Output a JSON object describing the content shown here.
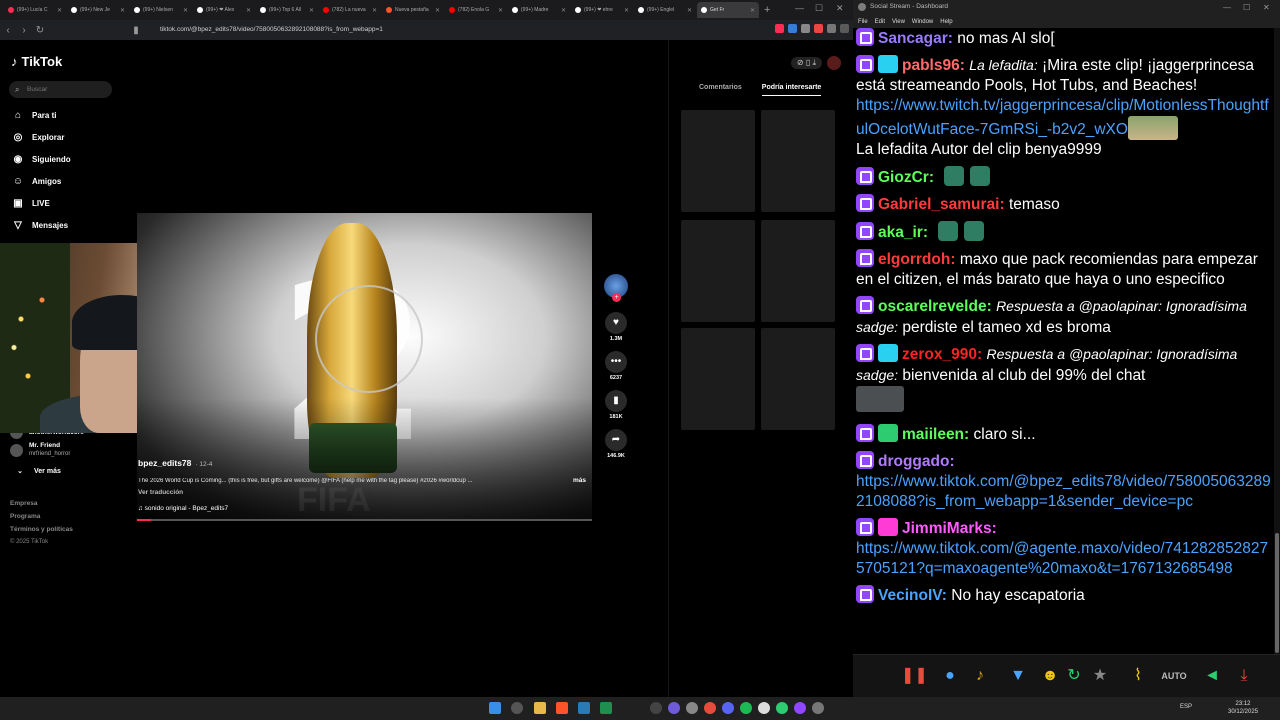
{
  "browser": {
    "tabs": [
      {
        "label": "(99+) Lucía C",
        "color": "#fe2c55",
        "active": false
      },
      {
        "label": "(99+) New Je",
        "color": "#ffffff",
        "active": false
      },
      {
        "label": "(99+) Nielsen",
        "color": "#ffffff",
        "active": false
      },
      {
        "label": "(99+) ❤ Alex",
        "color": "#ffffff",
        "active": false
      },
      {
        "label": "(99+) Top 6 All",
        "color": "#ffffff",
        "active": false
      },
      {
        "label": "(782) La nueva",
        "color": "#ff0000",
        "active": false
      },
      {
        "label": "Nueva pestaña",
        "color": "#fb542b",
        "active": false
      },
      {
        "label": "(782) Enola G",
        "color": "#ff0000",
        "active": false
      },
      {
        "label": "(99+) Madre",
        "color": "#ffffff",
        "active": false
      },
      {
        "label": "(99+) ❤ ehre",
        "color": "#ffffff",
        "active": false
      },
      {
        "label": "(99+) Englel",
        "color": "#ffffff",
        "active": false
      },
      {
        "label": "Get Fr",
        "color": "#ffffff",
        "active": true
      }
    ],
    "url": "tiktok.com/@bpez_edits78/video/7580050632892108088?is_from_webapp=1"
  },
  "tiktok": {
    "logo": "TikTok",
    "search_placeholder": "Buscar",
    "nav": [
      {
        "label": "Para ti",
        "icon": "home-icon",
        "glyph": "⌂"
      },
      {
        "label": "Explorar",
        "icon": "compass-icon",
        "glyph": "◎"
      },
      {
        "label": "Siguiendo",
        "icon": "following-icon",
        "glyph": "◉"
      },
      {
        "label": "Amigos",
        "icon": "friends-icon",
        "glyph": "☺"
      },
      {
        "label": "LIVE",
        "icon": "live-icon",
        "glyph": "▣"
      },
      {
        "label": "Mensajes",
        "icon": "messages-icon",
        "glyph": "▽"
      }
    ],
    "following_partial": "anotherworldcore",
    "following_user": {
      "name": "Mr. Friend",
      "handle": "mrfriend_horror"
    },
    "see_more": "Ver más",
    "footer": [
      "Empresa",
      "Programa",
      "Términos y políticas",
      "© 2025 TikTok"
    ],
    "video": {
      "author": "bpez_edits78",
      "date": "· 12-4",
      "description": "The 2026 World Cup is Coming... (this is free, but gifts are welcome) @FIFA (help me with the tag please) #2026 #worldcup ...",
      "more": "más",
      "translate": "Ver traducción",
      "sound": "♫  sonido original - Bpez_edits7",
      "progress": 0.03
    },
    "actions": {
      "likes": "1.3M",
      "comments": "6237",
      "saves": "181K",
      "shares": "146.9K"
    },
    "right_tabs": [
      "Comentarios",
      "Podría interesarte"
    ]
  },
  "dashboard": {
    "title": "Social Stream - Dashboard",
    "menu": [
      "File",
      "Edit",
      "View",
      "Window",
      "Help"
    ]
  },
  "chat": [
    {
      "user": "Sancagar",
      "color": "#9a7bff",
      "text": "no mas AI slo["
    },
    {
      "user": "pabls96",
      "color": "#ff6b6b",
      "reply": "La lefadita:",
      "text": "¡Mira este clip! ¡jaggerprincesa está streameando Pools, Hot Tubs, and Beaches!",
      "link": "https://www.twitch.tv/jaggerprincesa/clip/MotionlessThoughtfulOcelotWutFace-7GmRSi_-b2v2_wXO",
      "note": "La lefadita Autor del clip benya9999"
    },
    {
      "user": "GiozCr",
      "color": "#5cff5c",
      "text": ""
    },
    {
      "user": "Gabriel_samurai",
      "color": "#ff3b3b",
      "text": "temaso"
    },
    {
      "user": "aka_ir",
      "color": "#5cff5c",
      "text": ""
    },
    {
      "user": "elgorrdoh",
      "color": "#ff3b3b",
      "text": "maxo que pack recomiendas para empezar en el citizen, el más barato que haya o uno especifico"
    },
    {
      "user": "oscarelrevelde",
      "color": "#5cff5c",
      "reply": "Respuesta a @paolapinar: Ignoradísima sadge:",
      "text": "perdiste el tameo xd es broma"
    },
    {
      "user": "zerox_990",
      "color": "#ff2222",
      "reply": "Respuesta a @paolapinar: Ignoradísima sadge:",
      "text": "bienvenida al club del 99% del chat"
    },
    {
      "user": "maiileen",
      "color": "#5cff5c",
      "text": "claro si..."
    },
    {
      "user": "droggado",
      "color": "#b07bff",
      "text": "",
      "link": "https://www.tiktok.com/@bpez_edits78/video/7580050632892108088?is_from_webapp=1&sender_device=pc"
    },
    {
      "user": "JimmiMarks",
      "color": "#ff5cff",
      "text": "",
      "link": "https://www.tiktok.com/@agente.maxo/video/7412828528275705121?q=maxoagente%20maxo&t=1767132685498"
    },
    {
      "user": "VecinoIV",
      "color": "#4aa3ff",
      "text": "No hay escapatoria"
    }
  ],
  "controls": {
    "auto_label": "AUTO"
  },
  "taskbar": {
    "lang": "ESP",
    "time": "23:12",
    "date": "30/12/2025"
  }
}
